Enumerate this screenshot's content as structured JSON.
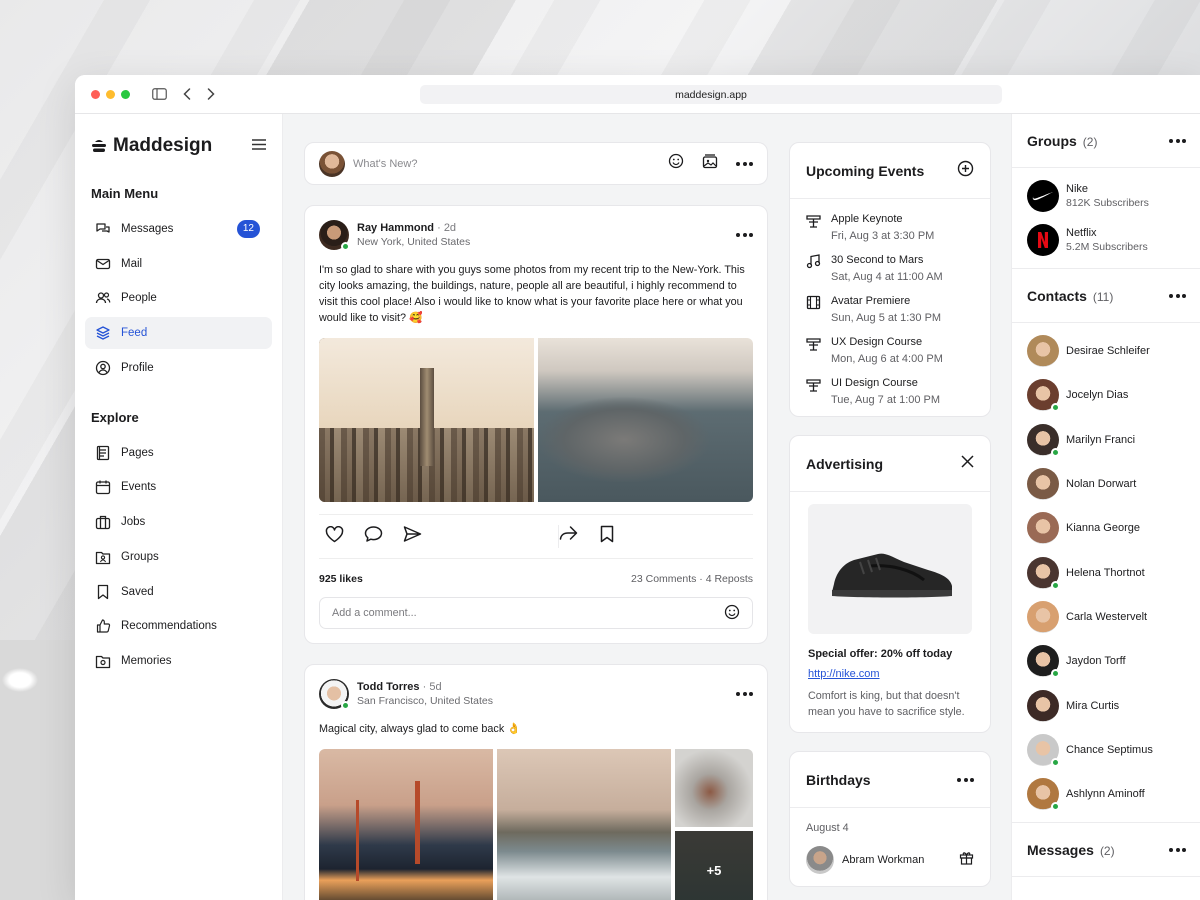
{
  "browser": {
    "url": "maddesign.app"
  },
  "brand": {
    "name": "Maddesign"
  },
  "sidebar": {
    "main_menu_title": "Main Menu",
    "main_items": [
      {
        "label": "Messages",
        "badge": "12"
      },
      {
        "label": "Mail"
      },
      {
        "label": "People"
      },
      {
        "label": "Feed",
        "active": true
      },
      {
        "label": "Profile"
      }
    ],
    "explore_title": "Explore",
    "explore_items": [
      {
        "label": "Pages"
      },
      {
        "label": "Events"
      },
      {
        "label": "Jobs"
      },
      {
        "label": "Groups"
      },
      {
        "label": "Saved"
      },
      {
        "label": "Recommendations"
      },
      {
        "label": "Memories"
      }
    ]
  },
  "composer": {
    "placeholder": "What's New?"
  },
  "posts": [
    {
      "author": "Ray Hammond",
      "time": "· 2d",
      "location": "New York, United States",
      "text": "I'm so glad to share with you guys some photos from my recent trip to the New-York. This city looks amazing, the buildings, nature, people all are beautiful, i highly recommend to visit this cool place! Also i would like to know what is your favorite place here or what you would like to visit? 🥰",
      "likes": "925 likes",
      "comments": "23 Comments",
      "reposts": "4 Reposts",
      "comment_placeholder": "Add a comment..."
    },
    {
      "author": "Todd Torres",
      "time": "· 5d",
      "location": "San Francisco, United States",
      "text": "Magical city, always glad to come back 👌",
      "more_photos": "+5"
    }
  ],
  "events": {
    "title": "Upcoming Events",
    "items": [
      {
        "title": "Apple Keynote",
        "date": "Fri, Aug 3 at 3:30 PM",
        "icon": "speaker-stand-icon"
      },
      {
        "title": "30 Second to Mars",
        "date": "Sat, Aug 4 at 11:00 AM",
        "icon": "music-note-icon"
      },
      {
        "title": "Avatar Premiere",
        "date": "Sun, Aug 5 at 1:30 PM",
        "icon": "film-icon"
      },
      {
        "title": "UX Design Course",
        "date": "Mon, Aug 6 at 4:00 PM",
        "icon": "speaker-stand-icon"
      },
      {
        "title": "UI Design Course",
        "date": "Tue, Aug 7 at 1:00 PM",
        "icon": "speaker-stand-icon"
      }
    ]
  },
  "advertising": {
    "title": "Advertising",
    "offer": "Special offer: 20% off today",
    "link": "http://nike.com",
    "description": "Comfort is king, but that doesn't mean you have to sacrifice style."
  },
  "birthdays": {
    "title": "Birthdays",
    "date": "August 4",
    "people": [
      {
        "name": "Abram Workman"
      }
    ]
  },
  "groups": {
    "title": "Groups",
    "count": "(2)",
    "items": [
      {
        "name": "Nike",
        "subscribers": "812K Subscribers"
      },
      {
        "name": "Netflix",
        "subscribers": "5.2M Subscribers"
      }
    ]
  },
  "contacts": {
    "title": "Contacts",
    "count": "(11)",
    "items": [
      {
        "name": "Desirae Schleifer",
        "online": false,
        "color": "#b08a5a"
      },
      {
        "name": "Jocelyn Dias",
        "online": true,
        "color": "#6b3e2e"
      },
      {
        "name": "Marilyn Franci",
        "online": true,
        "color": "#3a2e2a"
      },
      {
        "name": "Nolan Dorwart",
        "online": false,
        "color": "#7a5a45"
      },
      {
        "name": "Kianna George",
        "online": false,
        "color": "#9a6a55"
      },
      {
        "name": "Helena Thortnot",
        "online": true,
        "color": "#4a3530"
      },
      {
        "name": "Carla Westervelt",
        "online": false,
        "color": "#d8a070"
      },
      {
        "name": "Jaydon Torff",
        "online": true,
        "color": "#1e1e1e"
      },
      {
        "name": "Mira Curtis",
        "online": false,
        "color": "#3d2a26"
      },
      {
        "name": "Chance Septimus",
        "online": true,
        "color": "#c9c9c9"
      },
      {
        "name": "Ashlynn Aminoff",
        "online": true,
        "color": "#b07840"
      }
    ]
  },
  "messages_section": {
    "title": "Messages",
    "count": "(2)"
  }
}
